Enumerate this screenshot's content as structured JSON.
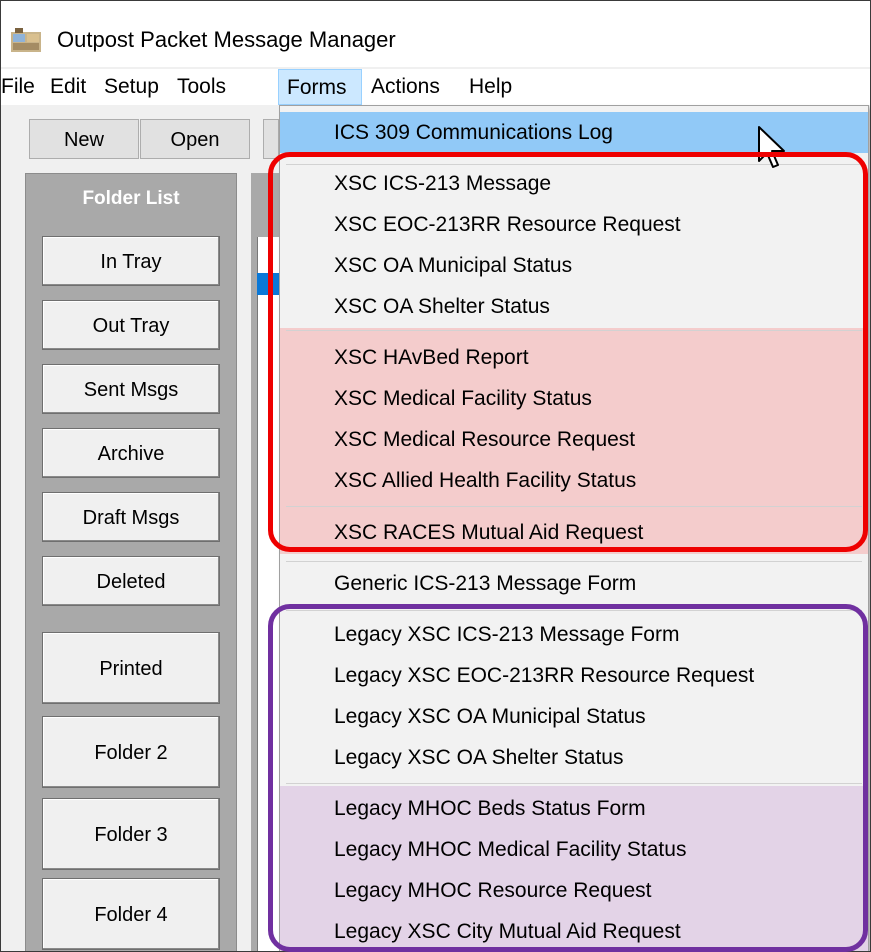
{
  "window": {
    "title": "Outpost Packet Message Manager",
    "icon": "app-icon"
  },
  "menubar": {
    "items": [
      "File",
      "Edit",
      "Setup",
      "Tools",
      "Forms",
      "Actions",
      "Help"
    ],
    "active": "Forms"
  },
  "toolbar": {
    "new_label": "New",
    "open_label": "Open"
  },
  "folders": {
    "title": "Folder List",
    "items": [
      "In Tray",
      "Out Tray",
      "Sent Msgs",
      "Archive",
      "Draft Msgs",
      "Deleted",
      "Printed",
      "Folder 2",
      "Folder 3",
      "Folder 4"
    ]
  },
  "forms_menu": {
    "items": [
      "ICS 309 Communications Log",
      "XSC ICS-213 Message",
      "XSC EOC-213RR Resource Request",
      "XSC OA Municipal Status",
      "XSC OA Shelter Status",
      "XSC HAvBed Report",
      "XSC Medical Facility Status",
      "XSC Medical Resource Request",
      "XSC Allied Health Facility Status",
      "XSC RACES Mutual Aid Request",
      "Generic ICS-213 Message Form",
      "Legacy XSC ICS-213 Message Form",
      "Legacy XSC EOC-213RR Resource Request",
      "Legacy XSC OA Municipal Status",
      "Legacy XSC OA Shelter Status",
      "Legacy MHOC Beds Status Form",
      "Legacy MHOC Medical Facility Status",
      "Legacy MHOC Resource Request",
      "Legacy XSC City Mutual Aid Request"
    ],
    "highlighted": "ICS 309 Communications Log"
  },
  "annotations": {
    "red_color": "#ee0000",
    "purple_color": "#7030a0"
  }
}
